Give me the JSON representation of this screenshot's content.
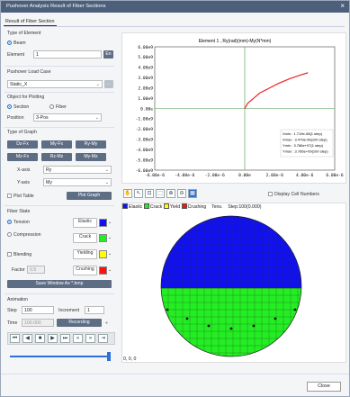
{
  "window": {
    "title": "Pushover Analysis Result of Fiber Sections"
  },
  "tab": "Result of Fiber Section",
  "type_of_element": {
    "header": "Type of Element",
    "beam": "Beam",
    "element_label": "Element",
    "element_value": "1",
    "en_button": "En"
  },
  "load_case": {
    "header": "Pushover Load Case",
    "value": "Static_X"
  },
  "plotting": {
    "header": "Object for Plotting",
    "section": "Section",
    "fiber": "Fiber",
    "position_label": "Position",
    "position_value": "3-Pos"
  },
  "graph_type": {
    "header": "Type of Graph",
    "buttons": [
      "Dz-Fx",
      "My-Fx",
      "Ry-My",
      "Mz-Fx",
      "Rz-Mz",
      "My-Mz"
    ],
    "x_axis_label": "X-axis",
    "x_axis_value": "Ry",
    "y_axis_label": "Y-axis",
    "y_axis_value": "My",
    "plot_table": "Plot Table",
    "plot_graph": "Plot Graph"
  },
  "fiber_state": {
    "header": "Fiber State",
    "tension": "Tension",
    "compression": "Compression",
    "elastic": "Elastic",
    "crack": "Crack",
    "blending": "Blending",
    "yielding": "Yielding",
    "factor_label": "Factor",
    "factor_value": "0.5",
    "crushing": "Crushing",
    "save_button": "Save Window As *.bmp",
    "colors": {
      "elastic": "#1010f0",
      "crack": "#22ee22",
      "yielding": "#ffff00",
      "crushing": "#ff1010"
    }
  },
  "animation": {
    "header": "Animation",
    "step_label": "Step",
    "step_value": "100",
    "increment_label": "Increment",
    "increment_value": "1",
    "time_label": "Time",
    "time_value": "100.000",
    "recording": "Recording",
    "controls": [
      "first",
      "prev",
      "stop",
      "next",
      "last",
      "rewind",
      "forward",
      "end"
    ]
  },
  "chart_data": {
    "type": "line",
    "title": "Element 1 , Ry(rad)(mm)-My(N*mm)",
    "y_ticks": [
      "6.00e9",
      "5.00e9",
      "4.00e9",
      "3.00e9",
      "2.00e9",
      "1.00e9",
      "0.00e",
      "-1.00e9",
      "-2.00e9",
      "-3.00e9",
      "-4.00e9",
      "-5.00e9",
      "-6.00e9"
    ],
    "x_ticks": [
      "-6.00e-6",
      "-4.00e-6",
      "-2.00e-6",
      "0.00e",
      "2.00e-6",
      "4.00e-6",
      "6.00e-6"
    ],
    "xlim": [
      -6e-06,
      6e-06
    ],
    "ylim": [
      -6000000000.0,
      6000000000.0
    ],
    "x": [
      0,
      2e-07,
      6e-07,
      1e-06,
      1.6e-06,
      2.2e-06,
      3e-06,
      3.7e-06,
      4.2e-06
    ],
    "y": [
      0,
      500000000.0,
      1000000000.0,
      1500000000.0,
      1950000000.0,
      2400000000.0,
      2900000000.0,
      3250000000.0,
      3470000000.0
    ],
    "stats": [
      "Xmin : 1.719e-08(1 step)",
      "Xmax : 3.479e-06(100 step)",
      "Ymin : 3.786e+07(1 step)",
      "Ymax : 3.766e+09(100 step)"
    ],
    "line_color": "#ee2222"
  },
  "fiber_view": {
    "display_cell_numbers": "Display Cell Numbers",
    "legend": {
      "elastic": "Elastic",
      "crack": "Crack",
      "yield": "Yield",
      "crushing": "Crushing",
      "tens": "Tens.",
      "step": "Step:100(0.000)"
    },
    "coord": "0, 0, 0",
    "tool_icons": [
      "pan-icon",
      "select-icon",
      "fit-icon",
      "zoom-window-icon",
      "zoom-in-icon",
      "zoom-out-icon",
      "grid-icon"
    ]
  },
  "close_button": "Close"
}
